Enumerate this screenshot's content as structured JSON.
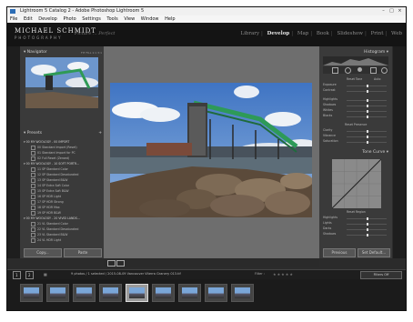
{
  "window": {
    "title": "Lightroom 5 Catalog 2 - Adobe Photoshop Lightroom 5",
    "controls": [
      "–",
      "□",
      "×"
    ]
  },
  "menu": [
    "File",
    "Edit",
    "Develop",
    "Photo",
    "Settings",
    "Tools",
    "View",
    "Window",
    "Help"
  ],
  "identity": {
    "name": "MICHAEL SCHMIDT",
    "tag": "PHOTOGRAPHY",
    "signature": "Picture ... Perfect"
  },
  "modules": [
    "Library",
    "Develop",
    "Map",
    "Book",
    "Slideshow",
    "Print",
    "Web"
  ],
  "active_module": "Develop",
  "navigator": {
    "title": "Navigator",
    "zoom": [
      "FIT",
      "FILL",
      "1:1",
      "3:1"
    ]
  },
  "presets": {
    "title": "Presets",
    "groups": [
      {
        "name": "00 MY WOOLOGY - 00 IMPORT",
        "items": [
          "00 Standard Import (Reset)",
          "01 Standard Import for PC",
          "02 Full Reset (Zeroed)"
        ]
      },
      {
        "name": "00 MY WOOLOGY - 10 SOFT PORTR...",
        "items": [
          "11 SP Standard Color",
          "12 SP Standard Desaturated",
          "13 SP Standard B&W",
          "14 SP Extra Soft Color",
          "15 SP Extra Soft B&W",
          "16 SP HDR Light",
          "17 SP HDR Strong",
          "18 SP HDR Max",
          "19 SP HDR B&W"
        ]
      },
      {
        "name": "00 MY WOOLOGY - 20 VIVID LANDS...",
        "items": [
          "21 VL Standard Color",
          "22 VL Standard Desaturated",
          "23 VL Standard B&W",
          "24 VL HDR Light"
        ]
      }
    ]
  },
  "left_buttons": {
    "copy": "Copy...",
    "paste": "Paste"
  },
  "histogram": {
    "title": "Histogram"
  },
  "basic": {
    "reset_tone": "Reset Tone",
    "auto": "Auto",
    "rows": [
      "Exposure",
      "Contrast",
      "Highlights",
      "Shadows",
      "Whites",
      "Blacks"
    ],
    "presence": "Reset Presence",
    "presence_rows": [
      "Clarity",
      "Vibrance",
      "Saturation"
    ]
  },
  "tone_curve": {
    "title": "Tone Curve",
    "region": "Reset Region",
    "rows": [
      "Highlights",
      "Lights",
      "Darks",
      "Shadows"
    ]
  },
  "right_buttons": {
    "previous": "Previous",
    "set_default": "Set Default..."
  },
  "bottom": {
    "pages": [
      "1",
      "2"
    ],
    "info": "9 photos / 1 selected / 2015-08-09 Vancouver Viterra Granery 013.tif",
    "filter": "Filter :",
    "filters_off": "Filters Off"
  },
  "filmstrip": {
    "count": 9,
    "selected_index": 4
  }
}
